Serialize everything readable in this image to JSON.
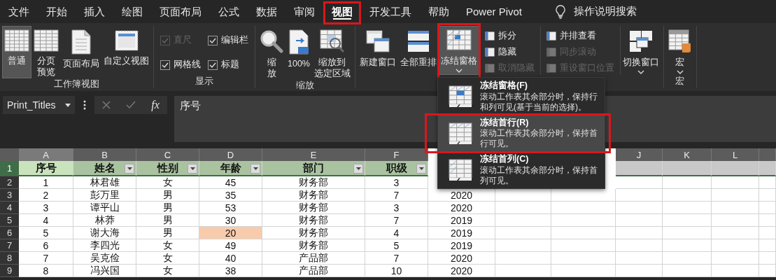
{
  "tabs": [
    {
      "label": "文件",
      "selected": false,
      "annotated": false
    },
    {
      "label": "开始",
      "selected": false,
      "annotated": false
    },
    {
      "label": "插入",
      "selected": false,
      "annotated": false
    },
    {
      "label": "绘图",
      "selected": false,
      "annotated": false
    },
    {
      "label": "页面布局",
      "selected": false,
      "annotated": false
    },
    {
      "label": "公式",
      "selected": false,
      "annotated": false
    },
    {
      "label": "数据",
      "selected": false,
      "annotated": false
    },
    {
      "label": "审阅",
      "selected": false,
      "annotated": false
    },
    {
      "label": "视图",
      "selected": true,
      "annotated": true
    },
    {
      "label": "开发工具",
      "selected": false,
      "annotated": false
    },
    {
      "label": "帮助",
      "selected": false,
      "annotated": false
    },
    {
      "label": "Power Pivot",
      "selected": false,
      "annotated": false
    }
  ],
  "search": {
    "label": "操作说明搜索"
  },
  "ribbon": {
    "groups": [
      {
        "label": "工作簿视图",
        "items": [
          {
            "kind": "large",
            "lines": [
              "普通"
            ],
            "selected": true,
            "dropdown": false,
            "annotated": false
          },
          {
            "kind": "large",
            "lines": [
              "分页",
              "预览"
            ],
            "selected": false,
            "dropdown": false,
            "annotated": false
          },
          {
            "kind": "large",
            "lines": [
              "页面布局"
            ],
            "selected": false,
            "dropdown": false,
            "annotated": false
          },
          {
            "kind": "large",
            "lines": [
              "自定义视图"
            ],
            "selected": false,
            "dropdown": false,
            "annotated": false
          }
        ]
      },
      {
        "label": "显示",
        "items": [
          {
            "kind": "checks",
            "items": [
              {
                "label": "直尺",
                "checked": true,
                "disabled": true
              },
              {
                "label": "编辑栏",
                "checked": true,
                "disabled": false
              },
              {
                "label": "网格线",
                "checked": true,
                "disabled": false
              },
              {
                "label": "标题",
                "checked": true,
                "disabled": false
              }
            ]
          }
        ]
      },
      {
        "label": "缩放",
        "items": [
          {
            "kind": "large",
            "lines": [
              "缩",
              "放"
            ],
            "selected": false,
            "dropdown": false,
            "annotated": false
          },
          {
            "kind": "large",
            "lines": [
              "100%"
            ],
            "selected": false,
            "dropdown": false,
            "annotated": false
          },
          {
            "kind": "large",
            "lines": [
              "缩放到",
              "选定区域"
            ],
            "selected": false,
            "dropdown": false,
            "annotated": false
          }
        ]
      },
      {
        "items": [
          {
            "kind": "large",
            "lines": [
              "新建窗口"
            ],
            "selected": false,
            "dropdown": false,
            "annotated": false
          },
          {
            "kind": "large",
            "lines": [
              "全部重排"
            ],
            "selected": false,
            "dropdown": false,
            "annotated": false
          },
          {
            "kind": "large",
            "lines": [
              "冻结窗格"
            ],
            "selected": true,
            "dropdown": true,
            "annotated": true
          },
          {
            "kind": "stack",
            "items": [
              {
                "label": "拆分",
                "disabled": false
              },
              {
                "label": "隐藏",
                "disabled": false
              },
              {
                "label": "取消隐藏",
                "disabled": true
              }
            ]
          },
          {
            "kind": "stack",
            "items": [
              {
                "label": "并排查看",
                "disabled": false
              },
              {
                "label": "同步滚动",
                "disabled": true
              },
              {
                "label": "重设窗口位置",
                "disabled": true
              }
            ]
          },
          {
            "kind": "large",
            "lines": [
              "切换窗口"
            ],
            "selected": false,
            "dropdown": true,
            "annotated": false
          }
        ]
      },
      {
        "label": "宏",
        "items": [
          {
            "kind": "large",
            "lines": [
              "宏"
            ],
            "selected": false,
            "dropdown": true,
            "annotated": false
          }
        ]
      }
    ]
  },
  "formula_bar": {
    "name_box": "Print_Titles",
    "function_label": "fx",
    "content": "序号"
  },
  "sheet": {
    "column_headers_left": [
      "A",
      "B",
      "C",
      "D",
      "E",
      "F"
    ],
    "column_headers_right": [
      "J",
      "K",
      "L"
    ],
    "header_row": {
      "number": "1",
      "cells": [
        {
          "text": "序号",
          "selected": true,
          "filter": false
        },
        {
          "text": "姓名",
          "selected": false,
          "filter": true
        },
        {
          "text": "性别",
          "selected": false,
          "filter": true
        },
        {
          "text": "年龄",
          "selected": false,
          "filter": true
        },
        {
          "text": "部门",
          "selected": false,
          "filter": true
        },
        {
          "text": "职级",
          "selected": false,
          "filter": true
        }
      ]
    },
    "rows": [
      {
        "number": "2",
        "cells": [
          {
            "text": "1",
            "highlighted": false
          },
          {
            "text": "林君雄",
            "highlighted": false
          },
          {
            "text": "女",
            "highlighted": false
          },
          {
            "text": "45",
            "highlighted": false
          },
          {
            "text": "财务部",
            "highlighted": false
          },
          {
            "text": "3",
            "highlighted": false
          }
        ]
      },
      {
        "number": "3",
        "cells": [
          {
            "text": "2",
            "highlighted": false
          },
          {
            "text": "彭万里",
            "highlighted": false
          },
          {
            "text": "男",
            "highlighted": false
          },
          {
            "text": "35",
            "highlighted": false
          },
          {
            "text": "财务部",
            "highlighted": false
          },
          {
            "text": "7",
            "highlighted": false
          },
          {
            "text": "2020",
            "highlighted": false
          }
        ]
      },
      {
        "number": "4",
        "cells": [
          {
            "text": "3",
            "highlighted": false
          },
          {
            "text": "谭平山",
            "highlighted": false
          },
          {
            "text": "男",
            "highlighted": false
          },
          {
            "text": "53",
            "highlighted": false
          },
          {
            "text": "财务部",
            "highlighted": false
          },
          {
            "text": "3",
            "highlighted": false
          },
          {
            "text": "2020",
            "highlighted": false
          }
        ]
      },
      {
        "number": "5",
        "cells": [
          {
            "text": "4",
            "highlighted": false
          },
          {
            "text": "林莽",
            "highlighted": false
          },
          {
            "text": "男",
            "highlighted": false
          },
          {
            "text": "30",
            "highlighted": false
          },
          {
            "text": "财务部",
            "highlighted": false
          },
          {
            "text": "7",
            "highlighted": false
          },
          {
            "text": "2019",
            "highlighted": false
          }
        ]
      },
      {
        "number": "6",
        "cells": [
          {
            "text": "5",
            "highlighted": false
          },
          {
            "text": "谢大海",
            "highlighted": false
          },
          {
            "text": "男",
            "highlighted": false
          },
          {
            "text": "20",
            "highlighted": true
          },
          {
            "text": "财务部",
            "highlighted": false
          },
          {
            "text": "4",
            "highlighted": false
          },
          {
            "text": "2019",
            "highlighted": false
          }
        ]
      },
      {
        "number": "7",
        "cells": [
          {
            "text": "6",
            "highlighted": false
          },
          {
            "text": "李四光",
            "highlighted": false
          },
          {
            "text": "女",
            "highlighted": false
          },
          {
            "text": "49",
            "highlighted": false
          },
          {
            "text": "财务部",
            "highlighted": false
          },
          {
            "text": "5",
            "highlighted": false
          },
          {
            "text": "2019",
            "highlighted": false
          }
        ]
      },
      {
        "number": "8",
        "cells": [
          {
            "text": "7",
            "highlighted": false
          },
          {
            "text": "吴克俭",
            "highlighted": false
          },
          {
            "text": "女",
            "highlighted": false
          },
          {
            "text": "40",
            "highlighted": false
          },
          {
            "text": "产品部",
            "highlighted": false
          },
          {
            "text": "7",
            "highlighted": false
          },
          {
            "text": "2020",
            "highlighted": false
          }
        ]
      },
      {
        "number": "9",
        "cells": [
          {
            "text": "8",
            "highlighted": false
          },
          {
            "text": "冯兴国",
            "highlighted": false
          },
          {
            "text": "女",
            "highlighted": false
          },
          {
            "text": "38",
            "highlighted": false
          },
          {
            "text": "产品部",
            "highlighted": false
          },
          {
            "text": "10",
            "highlighted": false
          },
          {
            "text": "2020",
            "highlighted": false
          }
        ]
      }
    ]
  },
  "freeze_menu": {
    "items": [
      {
        "title": "冻结窗格(F)",
        "description": "滚动工作表其余部分时，保持行和列可见(基于当前的选择)。",
        "selected": false,
        "annotated": false
      },
      {
        "title": "冻结首行(R)",
        "description": "滚动工作表其余部分时，保持首行可见。",
        "selected": true,
        "annotated": true
      },
      {
        "title": "冻结首列(C)",
        "description": "滚动工作表其余部分时，保持首列可见。",
        "selected": false,
        "annotated": false
      }
    ]
  }
}
